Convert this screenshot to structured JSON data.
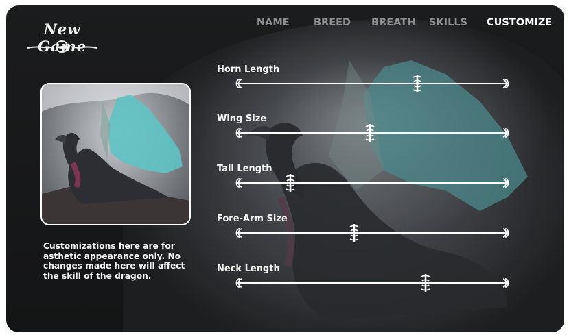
{
  "logo": {
    "text": "New Game"
  },
  "nav": [
    {
      "label": "NAME",
      "active": false
    },
    {
      "label": "BREED",
      "active": false
    },
    {
      "label": "BREATH",
      "active": false
    },
    {
      "label": "SKILLS",
      "active": false
    },
    {
      "label": "CUSTOMIZE",
      "active": true
    }
  ],
  "preview": {
    "icon": "dragon-portrait"
  },
  "description": "Customizations here are for asthetic appearance only. No changes made here will affect the skill of the dragon.",
  "sliders": [
    {
      "label": "Horn Length",
      "value": 0.67
    },
    {
      "label": "Wing Size",
      "value": 0.49
    },
    {
      "label": "Tail Length",
      "value": 0.19
    },
    {
      "label": "Fore-Arm Size",
      "value": 0.43
    },
    {
      "label": "Neck Length",
      "value": 0.7
    }
  ],
  "colors": {
    "panel": "#18191a",
    "text": "#ffffff",
    "nav_inactive": "#8e9093"
  }
}
